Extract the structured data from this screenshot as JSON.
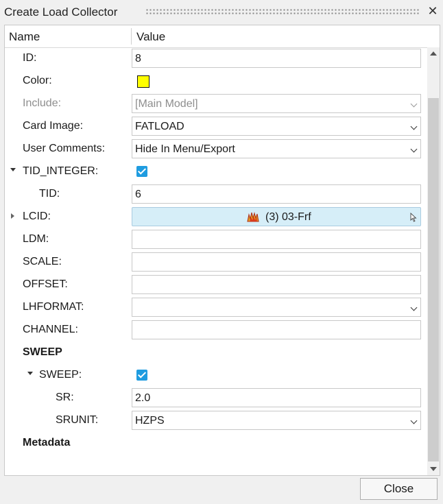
{
  "window": {
    "title": "Create Load Collector"
  },
  "header": {
    "name": "Name",
    "value": "Value"
  },
  "rows": {
    "id": {
      "label": "ID:",
      "value": "8"
    },
    "color": {
      "label": "Color:",
      "swatch": "#ffff00"
    },
    "include": {
      "label": "Include:",
      "value": "[Main Model]"
    },
    "card_image": {
      "label": "Card Image:",
      "value": "FATLOAD"
    },
    "user_comments": {
      "label": "User Comments:",
      "value": "Hide In Menu/Export"
    },
    "tid_integer": {
      "label": "TID_INTEGER:",
      "checked": true
    },
    "tid": {
      "label": "TID:",
      "value": "6"
    },
    "lcid": {
      "label": "LCID:",
      "value": "(3) 03-Frf",
      "icon": "load-collector-icon"
    },
    "ldm": {
      "label": "LDM:",
      "value": ""
    },
    "scale": {
      "label": "SCALE:",
      "value": ""
    },
    "offset": {
      "label": "OFFSET:",
      "value": ""
    },
    "lhformat": {
      "label": "LHFORMAT:",
      "value": ""
    },
    "channel": {
      "label": "CHANNEL:",
      "value": ""
    },
    "sweep_group": {
      "label": "SWEEP"
    },
    "sweep": {
      "label": "SWEEP:",
      "checked": true
    },
    "sr": {
      "label": "SR:",
      "value": "2.0"
    },
    "srunit": {
      "label": "SRUNIT:",
      "value": "HZPS"
    },
    "metadata": {
      "label": "Metadata"
    }
  },
  "footer": {
    "close_label": "Close"
  },
  "colors": {
    "accent": "#1f9ce0",
    "entity_bg": "#d6eef8",
    "swatch": "#ffff00"
  }
}
